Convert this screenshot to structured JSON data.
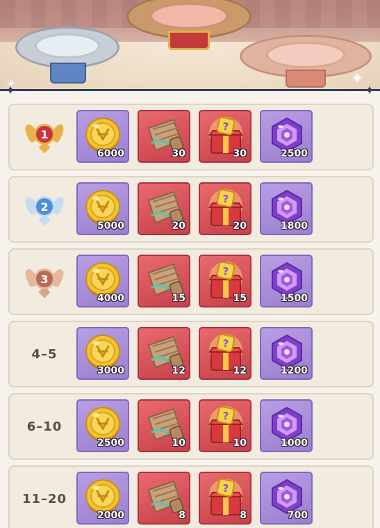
{
  "scene": {
    "podiums": [
      "second-place-podium",
      "first-place-podium",
      "third-place-podium"
    ]
  },
  "rewards": {
    "item_types": [
      "gold-coin-icon",
      "treasure-map-scroll-icon",
      "mystery-gift-box-icon",
      "purple-gem-icon"
    ],
    "rows": [
      {
        "rank": "1",
        "rank_style": "medal-gold",
        "quantities": [
          "6000",
          "30",
          "30",
          "2500"
        ]
      },
      {
        "rank": "2",
        "rank_style": "medal-silver",
        "quantities": [
          "5000",
          "20",
          "20",
          "1800"
        ]
      },
      {
        "rank": "3",
        "rank_style": "medal-bronze",
        "quantities": [
          "4000",
          "15",
          "15",
          "1500"
        ]
      },
      {
        "rank": "4–5",
        "rank_style": "text",
        "quantities": [
          "3000",
          "12",
          "12",
          "1200"
        ]
      },
      {
        "rank": "6–10",
        "rank_style": "text",
        "quantities": [
          "2500",
          "10",
          "10",
          "1000"
        ]
      },
      {
        "rank": "11–20",
        "rank_style": "text",
        "quantities": [
          "2000",
          "8",
          "8",
          "700"
        ]
      }
    ]
  },
  "colors": {
    "medal_gold": "#c8363c",
    "medal_silver": "#4f8fd6",
    "medal_bronze": "#b86a55",
    "slot_purple": "#9b7fd0",
    "slot_red": "#c7414a"
  }
}
